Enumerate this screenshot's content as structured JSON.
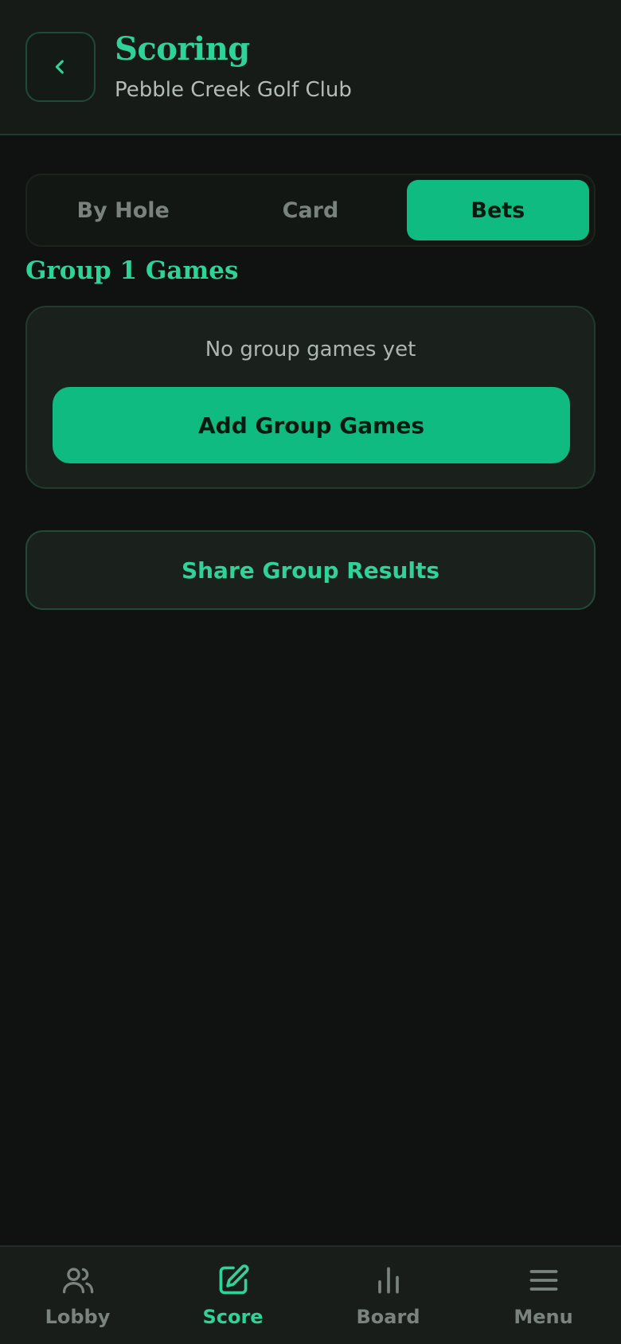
{
  "header": {
    "title": "Scoring",
    "subtitle": "Pebble Creek Golf Club",
    "back_icon": "chevron-left-icon"
  },
  "tabs": [
    {
      "label": "By Hole",
      "active": false
    },
    {
      "label": "Card",
      "active": false
    },
    {
      "label": "Bets",
      "active": true
    }
  ],
  "section": {
    "title": "Group 1 Games"
  },
  "games_card": {
    "empty_text": "No group games yet",
    "add_button": "Add Group Games"
  },
  "share_button": "Share Group Results",
  "bottom_nav": [
    {
      "label": "Lobby",
      "icon": "users-icon",
      "active": false
    },
    {
      "label": "Score",
      "icon": "edit-icon",
      "active": true
    },
    {
      "label": "Board",
      "icon": "bar-chart-icon",
      "active": false
    },
    {
      "label": "Menu",
      "icon": "menu-icon",
      "active": false
    }
  ],
  "colors": {
    "accent": "#10bb82",
    "accent_text": "#2fd39a",
    "background": "#0f1210",
    "surface": "#1a211c"
  }
}
